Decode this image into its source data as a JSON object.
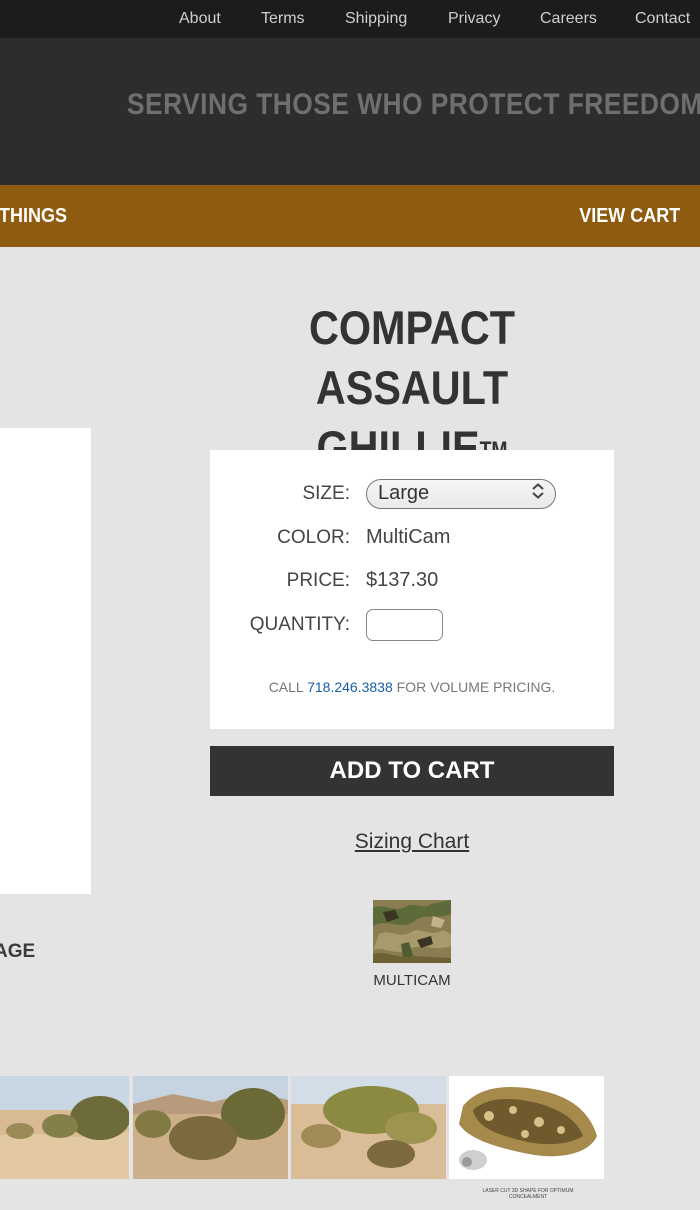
{
  "topnav": {
    "items": [
      "About",
      "Terms",
      "Shipping",
      "Privacy",
      "Careers",
      "Contact"
    ]
  },
  "banner": {
    "tagline": "SERVING THOSE WHO PROTECT FREEDOM"
  },
  "catbar": {
    "left_label": "- THINGS",
    "cart_label": "VIEW CART"
  },
  "product": {
    "title": "COMPACT ASSAULT GHILLIE",
    "trademark": "TM",
    "size_label": "SIZE:",
    "size_value": "Large",
    "color_label": "COLOR:",
    "color_value": "MultiCam",
    "price_label": "PRICE:",
    "price_value": "$137.30",
    "quantity_label": "QUANTITY:",
    "quantity_value": "",
    "call_prefix": "CALL",
    "call_phone": "718.246.3838",
    "call_suffix": "FOR VOLUME PRICING.",
    "add_to_cart": "ADD TO CART",
    "sizing_chart": "Sizing Chart",
    "swatch_label": "MULTICAM"
  },
  "gallery": {
    "partial_label": "AGE",
    "thumb_caption": "LASER CUT 3D SHAPE FOR OPTIMUM CONCEALMENT"
  },
  "colors": {
    "topnav_bg": "#1c1c1c",
    "banner_bg": "#2d2d2d",
    "catbar_bg": "#8f5b0f",
    "button_bg": "#333333",
    "link_blue": "#1a5ea8",
    "page_bg": "#e4e4e4"
  }
}
